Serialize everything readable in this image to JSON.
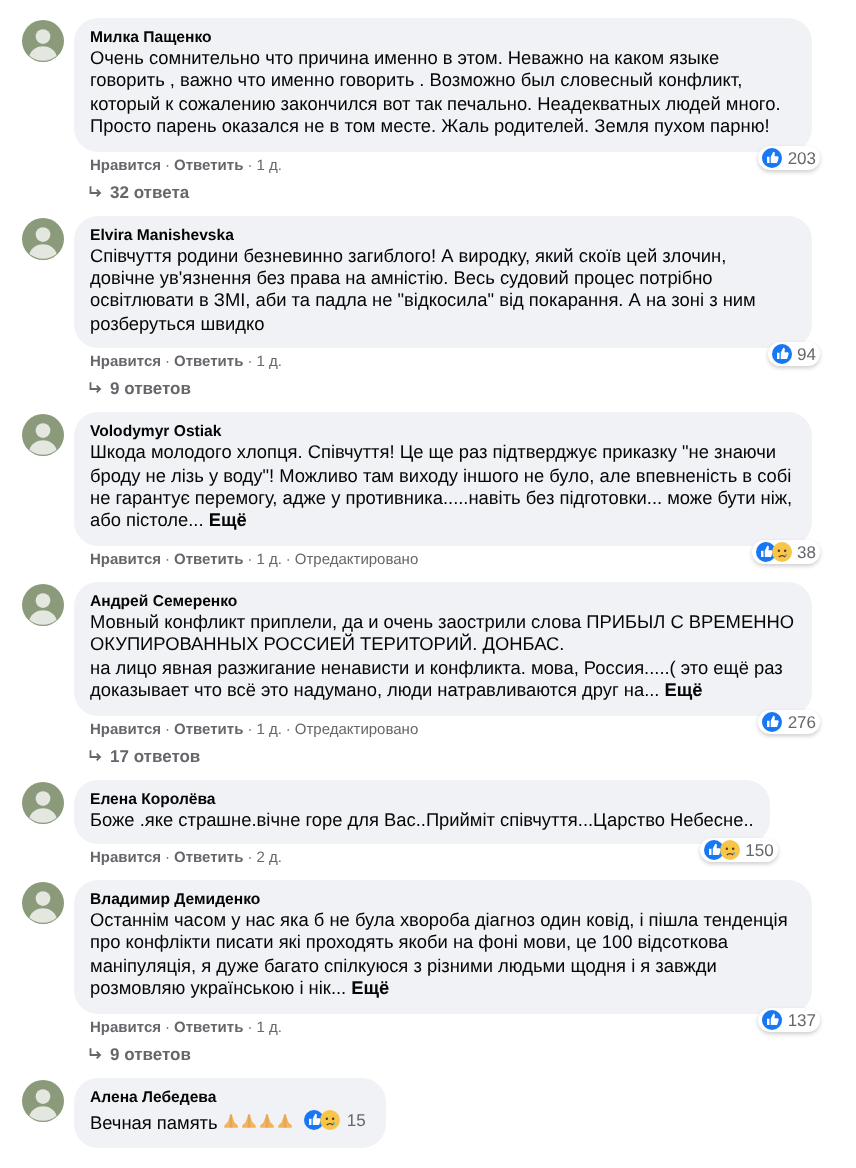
{
  "separator": "·",
  "comments": [
    {
      "author": "Милка Пащенко",
      "text": "Очень сомнительно что причина именно в этом. Неважно на каком языке говорить , важно что именно говорить . Возможно был словесный конфликт, который к сожалению закончился вот так печально. Неадекватных людей много. Просто парень оказался не в том месте. Жаль родителей. Земля пухом парню!",
      "like": "Нравится",
      "reply": "Ответить",
      "time": "1 д.",
      "reactions": [
        {
          "kind": "like"
        }
      ],
      "reaction_count": "203",
      "reactions_inline": false,
      "replies": "32 ответа"
    },
    {
      "author": "Elvira Manishevska",
      "text": "Співчуття родини безневинно загиблого! А виродку, який скоїв цей злочин, довічне ув'язнення без права на амністію. Весь судовий процес потрібно освітлювати в ЗМІ, аби та падла не \"відкосила\" від покарання. А на зоні з ним розберуться швидко",
      "like": "Нравится",
      "reply": "Ответить",
      "time": "1 д.",
      "reactions": [
        {
          "kind": "like"
        }
      ],
      "reaction_count": "94",
      "reactions_inline": false,
      "replies": "9 ответов"
    },
    {
      "author": "Volodymyr Ostiak",
      "text": "Шкода молодого хлопця. Співчуття! Це ще раз підтверджує приказку \"не знаючи броду не лізь у воду\"! Можливо там виходу іншого не було, але впевненість в собі не гарантує перемогу, адже у противника.....навіть без підготовки... може бути ніж, або пістоле...",
      "more": "Ещё",
      "like": "Нравится",
      "reply": "Ответить",
      "time": "1 д.",
      "edited": "Отредактировано",
      "reactions": [
        {
          "kind": "like"
        },
        {
          "kind": "sad"
        }
      ],
      "reaction_count": "38",
      "reactions_inline": false
    },
    {
      "author": "Андрей Семеренко",
      "text": "Мовный конфликт приплели, да и очень заострили слова ПРИБЫЛ С ВРЕМЕННО ОКУПИРОВАННЫХ РОССИЕЙ ТЕРИТОРИЙ. ДОНБАС.\nна лицо явная разжигание ненависти и конфликта. мова, Россия.....( это ещё раз доказывает что всё это надумано, люди натравливаются друг на...",
      "more": "Ещё",
      "like": "Нравится",
      "reply": "Ответить",
      "time": "1 д.",
      "edited": "Отредактировано",
      "reactions": [
        {
          "kind": "like"
        }
      ],
      "reaction_count": "276",
      "reactions_inline": false,
      "replies": "17 ответов"
    },
    {
      "author": "Елена Королёва",
      "text": "Боже .яке страшне.вічне горе для Вас..Прийміт співчуття...Царство Небесне..",
      "like": "Нравится",
      "reply": "Ответить",
      "time": "2 д.",
      "reactions": [
        {
          "kind": "like"
        },
        {
          "kind": "sad"
        }
      ],
      "reaction_count": "150",
      "reactions_inline": false
    },
    {
      "author": "Владимир Демиденко",
      "text": "Останнім часом у нас яка б не була хвороба діагноз один ковід, і пішла тенденція про конфлікти писати які проходять якоби на фоні мови, це 100 відсоткова маніпуляція, я дуже багато спілкуюся з різними людьми щодня і я завжди розмовляю українською і нік...",
      "more": "Ещё",
      "like": "Нравится",
      "reply": "Ответить",
      "time": "1 д.",
      "reactions": [
        {
          "kind": "like"
        }
      ],
      "reaction_count": "137",
      "reactions_inline": false,
      "replies": "9 ответов"
    },
    {
      "author": "Алена Лебедева",
      "text": "Вечная память",
      "emojis": [
        {
          "kind": "pray"
        },
        {
          "kind": "pray"
        },
        {
          "kind": "pray"
        },
        {
          "kind": "pray"
        }
      ],
      "reactions": [
        {
          "kind": "like"
        },
        {
          "kind": "sad"
        }
      ],
      "reaction_count": "15",
      "reactions_inline": true
    }
  ]
}
